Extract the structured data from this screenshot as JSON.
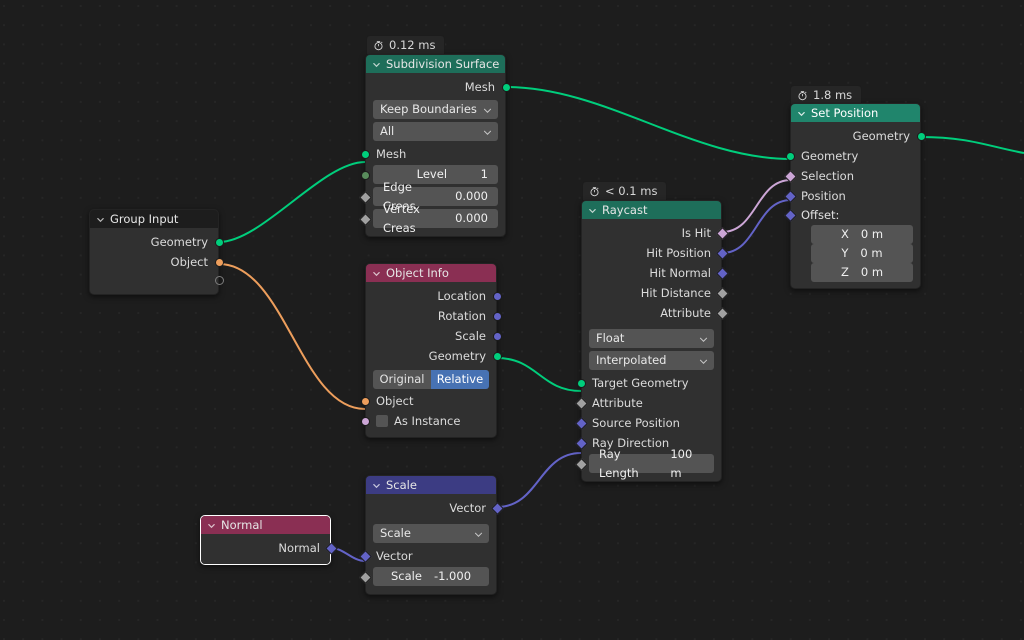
{
  "editor": {
    "name": "geometry-node-editor",
    "background": "#1d1d1d",
    "grid_dot": "#262626"
  },
  "colors": {
    "geometry_socket": "#00ce7c",
    "object_socket": "#ed9e5c",
    "vector_socket": "#6363c7",
    "float_socket": "#a1a1a1",
    "boolean_socket": "#cca6d6",
    "integer_socket": "#598c5c",
    "header_geometry": "#1e6e5a",
    "header_input_red": "#8a2f53",
    "header_vector": "#3c3c83",
    "node_body": "#303030",
    "widget": "#545454",
    "toggle_active": "#4772b3"
  },
  "nodes": {
    "group_input": {
      "title": "Group Input",
      "header_color": "#1d1d1d",
      "outputs": [
        {
          "label": "Geometry",
          "type": "geometry"
        },
        {
          "label": "Object",
          "type": "object"
        },
        {
          "label": "",
          "type": "empty"
        }
      ]
    },
    "subdivision_surface": {
      "title": "Subdivision Surface",
      "timing": "0.12 ms",
      "header_color": "#1e6e5a",
      "outputs": [
        {
          "label": "Mesh",
          "type": "geometry"
        }
      ],
      "dropdowns": [
        {
          "name": "uv_smooth",
          "value": "Keep Boundaries"
        },
        {
          "name": "boundary_smooth",
          "value": "All"
        }
      ],
      "inputs": [
        {
          "label": "Mesh",
          "type": "geometry"
        }
      ],
      "fields": [
        {
          "label": "Level",
          "value": "1",
          "type": "integer"
        },
        {
          "label": "Edge Creas",
          "value": "0.000",
          "type": "float"
        },
        {
          "label": "Vertex Creas",
          "value": "0.000",
          "type": "float"
        }
      ]
    },
    "object_info": {
      "title": "Object Info",
      "header_color": "#8a2f53",
      "outputs": [
        {
          "label": "Location",
          "type": "vector"
        },
        {
          "label": "Rotation",
          "type": "vector"
        },
        {
          "label": "Scale",
          "type": "vector"
        },
        {
          "label": "Geometry",
          "type": "geometry"
        }
      ],
      "transform_space": {
        "options": [
          "Original",
          "Relative"
        ],
        "selected": "Relative"
      },
      "inputs": [
        {
          "label": "Object",
          "type": "object"
        },
        {
          "label": "As Instance",
          "type": "boolean",
          "checkbox": true,
          "checked": false
        }
      ]
    },
    "raycast": {
      "title": "Raycast",
      "timing": "< 0.1 ms",
      "header_color": "#1e6e5a",
      "outputs": [
        {
          "label": "Is Hit",
          "type": "boolean"
        },
        {
          "label": "Hit Position",
          "type": "vector"
        },
        {
          "label": "Hit Normal",
          "type": "vector"
        },
        {
          "label": "Hit Distance",
          "type": "float"
        },
        {
          "label": "Attribute",
          "type": "float"
        }
      ],
      "dropdowns": [
        {
          "name": "data_type",
          "value": "Float"
        },
        {
          "name": "mapping",
          "value": "Interpolated"
        }
      ],
      "inputs": [
        {
          "label": "Target Geometry",
          "type": "geometry"
        },
        {
          "label": "Attribute",
          "type": "float"
        },
        {
          "label": "Source Position",
          "type": "vector"
        },
        {
          "label": "Ray Direction",
          "type": "vector"
        }
      ],
      "fields": [
        {
          "label": "Ray Length",
          "value": "100 m",
          "type": "float"
        }
      ]
    },
    "set_position": {
      "title": "Set Position",
      "timing": "1.8 ms",
      "header_color": "#20856c",
      "selected": false,
      "outputs": [
        {
          "label": "Geometry",
          "type": "geometry"
        }
      ],
      "inputs": [
        {
          "label": "Geometry",
          "type": "geometry"
        },
        {
          "label": "Selection",
          "type": "boolean"
        },
        {
          "label": "Position",
          "type": "vector"
        },
        {
          "label": "Offset:",
          "type": "vector"
        }
      ],
      "offset_fields": [
        {
          "label": "X",
          "value": "0 m"
        },
        {
          "label": "Y",
          "value": "0 m"
        },
        {
          "label": "Z",
          "value": "0 m"
        }
      ]
    },
    "scale": {
      "title": "Scale",
      "header_color": "#3c3c83",
      "outputs": [
        {
          "label": "Vector",
          "type": "vector"
        }
      ],
      "dropdowns": [
        {
          "name": "operation",
          "value": "Scale"
        }
      ],
      "inputs": [
        {
          "label": "Vector",
          "type": "vector"
        }
      ],
      "fields": [
        {
          "label": "Scale",
          "value": "-1.000",
          "type": "float"
        }
      ]
    },
    "normal": {
      "title": "Normal",
      "header_color": "#8a2f53",
      "selected": true,
      "outputs": [
        {
          "label": "Normal",
          "type": "vector"
        }
      ]
    }
  },
  "links": [
    {
      "from": "group_input.Geometry",
      "to": "subdivision_surface.Mesh",
      "color": "#00ce7c"
    },
    {
      "from": "group_input.Object",
      "to": "object_info.Object",
      "color": "#ed9e5c"
    },
    {
      "from": "subdivision_surface.Mesh",
      "to": "set_position.Geometry",
      "color": "#00ce7c"
    },
    {
      "from": "object_info.Geometry",
      "to": "raycast.Target Geometry",
      "color": "#00ce7c"
    },
    {
      "from": "normal.Normal",
      "to": "scale.Vector",
      "color": "#6363c7"
    },
    {
      "from": "scale.Vector",
      "to": "raycast.Ray Direction",
      "color": "#6363c7"
    },
    {
      "from": "raycast.Is Hit",
      "to": "set_position.Selection",
      "color": "#cca6d6"
    },
    {
      "from": "raycast.Hit Position",
      "to": "set_position.Position",
      "color": "#6363c7"
    },
    {
      "from": "set_position.Geometry",
      "to": "offscreen",
      "color": "#00ce7c"
    }
  ]
}
